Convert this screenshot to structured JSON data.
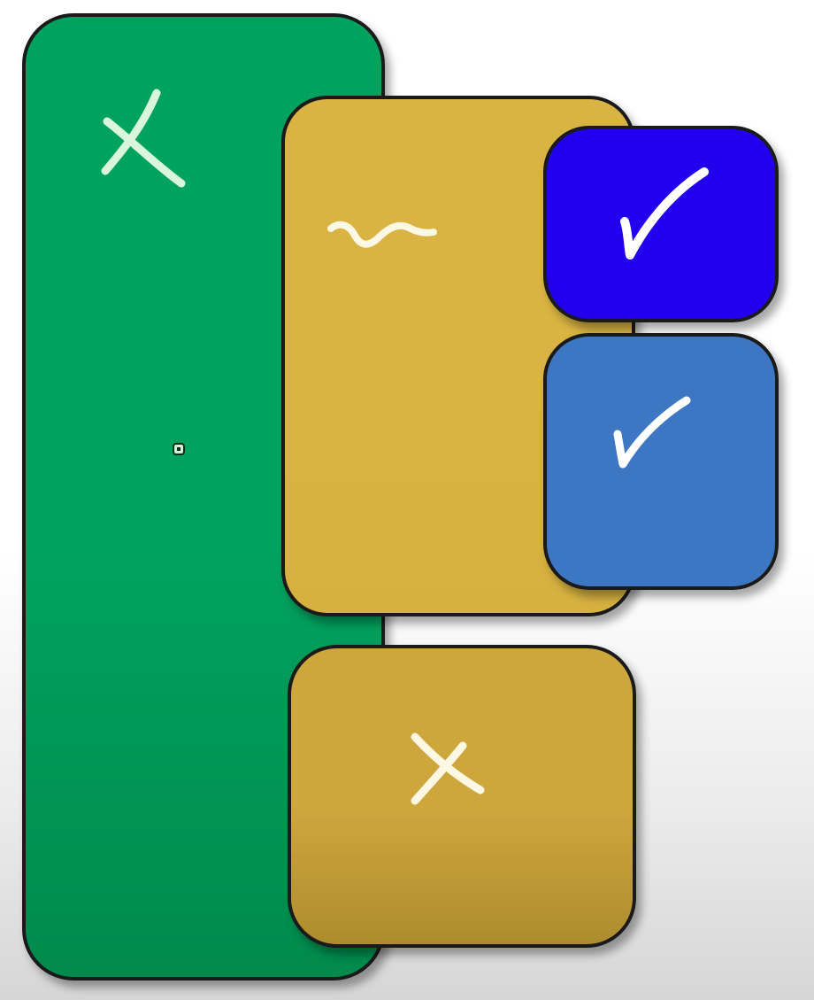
{
  "colors": {
    "background": "#ffffff",
    "outline": "#1a1a1a",
    "green_top": "#00a35e",
    "green_bottom": "#008a4c",
    "gold_top": "#d9b442",
    "gold_bottom": "#b8952f",
    "blue_dark": "#2200ee",
    "blue_light": "#3d77c4",
    "mark_light": "#d9f5dc",
    "mark_cream": "#fdf8e4",
    "mark_white": "#ffffff"
  },
  "boxes": [
    {
      "id": "green",
      "fill_top": "#00a35e",
      "fill_bottom": "#008a4c",
      "mark": "cross-icon"
    },
    {
      "id": "gold-top",
      "fill_top": "#d9b442",
      "fill_bottom": "#d6b140",
      "mark": "squiggle-icon"
    },
    {
      "id": "blue-dark",
      "fill_top": "#2200ee",
      "fill_bottom": "#2200ee",
      "mark": "check-icon"
    },
    {
      "id": "blue-light",
      "fill_top": "#3d77c4",
      "fill_bottom": "#3d77c4",
      "mark": "check-icon"
    },
    {
      "id": "gold-bottom",
      "fill_top": "#cda63c",
      "fill_bottom": "#ae8c2e",
      "mark": "cross-icon"
    }
  ]
}
